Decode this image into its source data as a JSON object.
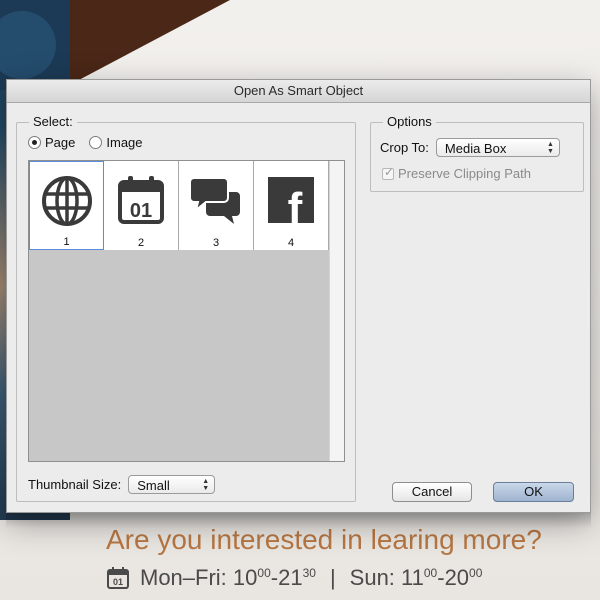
{
  "dialog": {
    "title": "Open As Smart Object",
    "select_group": {
      "legend": "Select:",
      "radios": [
        {
          "label": "Page",
          "checked": true
        },
        {
          "label": "Image",
          "checked": false
        }
      ],
      "thumbnails": [
        {
          "label": "1",
          "icon": "globe-icon",
          "selected": true
        },
        {
          "label": "2",
          "icon": "calendar-01-icon",
          "selected": false
        },
        {
          "label": "3",
          "icon": "speech-bubbles-icon",
          "selected": false
        },
        {
          "label": "4",
          "icon": "facebook-icon",
          "selected": false
        }
      ],
      "calendar_day": "01",
      "facebook_glyph": "f",
      "thumbnail_size_label": "Thumbnail Size:",
      "thumbnail_size_value": "Small"
    },
    "options_group": {
      "legend": "Options",
      "crop_to_label": "Crop To:",
      "crop_to_value": "Media Box",
      "preserve_clipping_label": "Preserve Clipping Path",
      "preserve_clipping_checked": true,
      "preserve_clipping_enabled": false
    },
    "buttons": {
      "cancel": "Cancel",
      "ok": "OK"
    }
  },
  "background": {
    "promo_text": "Are you interested in learing more?",
    "hours": {
      "calendar_day": "01",
      "weekday_label": "Mon–Fri: ",
      "weekday_open": "10",
      "weekday_open_min": "00",
      "weekday_dash": "-",
      "weekday_close": "21",
      "weekday_close_min": "30",
      "separator": "|",
      "sunday_label": "Sun: ",
      "sunday_open": "11",
      "sunday_open_min": "00",
      "sunday_dash": "-",
      "sunday_close": "20",
      "sunday_close_min": "00"
    }
  },
  "colors": {
    "accent_text": "#b87743",
    "thumb_bg": "#c7c7c7",
    "ok_button": "#aebfd6"
  }
}
